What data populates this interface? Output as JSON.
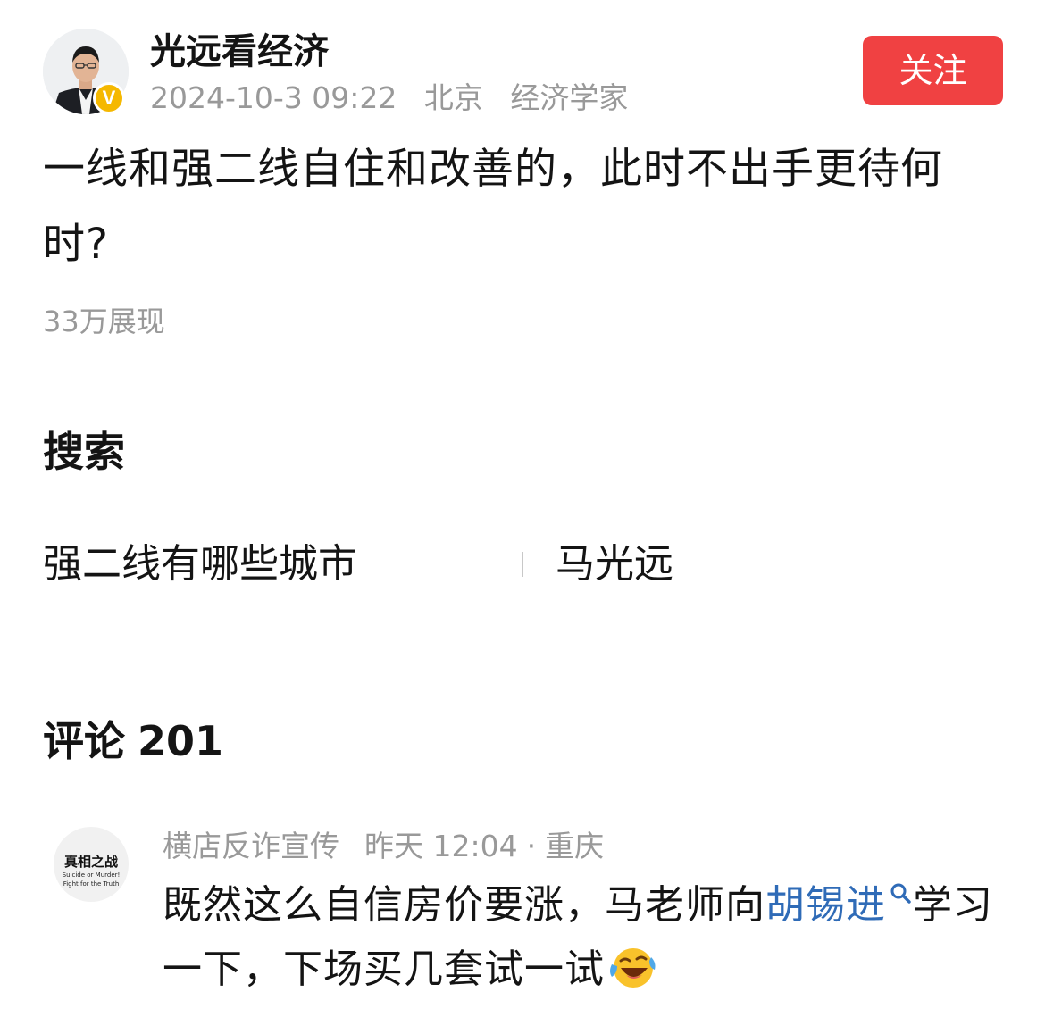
{
  "post": {
    "author": {
      "name": "光远看经济",
      "verified_badge": "V",
      "avatar_icon": "author-avatar-photo"
    },
    "meta": {
      "datetime": "2024-10-3 09:22",
      "location": "北京",
      "role": "经济学家"
    },
    "follow_label": "关注",
    "text": "一线和强二线自住和改善的，此时不出手更待何时?",
    "views": "33万展现"
  },
  "search": {
    "title": "搜索",
    "items": [
      {
        "label": "强二线有哪些城市"
      },
      {
        "label": "马光远"
      }
    ]
  },
  "comments": {
    "title": "评论",
    "count": "201",
    "items": [
      {
        "author": "横店反诈宣传",
        "time": "昨天 12:04",
        "separator": "·",
        "location": "重庆",
        "avatar_logo": {
          "main": "真相之战",
          "sub1": "Suicide or Murder!",
          "sub2": "Fight for the Truth"
        },
        "text_before_link": "既然这么自信房价要涨，马老师向",
        "link_text": "胡锡进",
        "text_after_link": "学习一下，下场买几套试一试",
        "emoji": "laughing-crying-emoji"
      }
    ]
  },
  "colors": {
    "follow_button": "#f04142",
    "verified_badge": "#f5b800",
    "link": "#2f6bb7",
    "meta_gray": "#999999",
    "text": "#141414"
  }
}
